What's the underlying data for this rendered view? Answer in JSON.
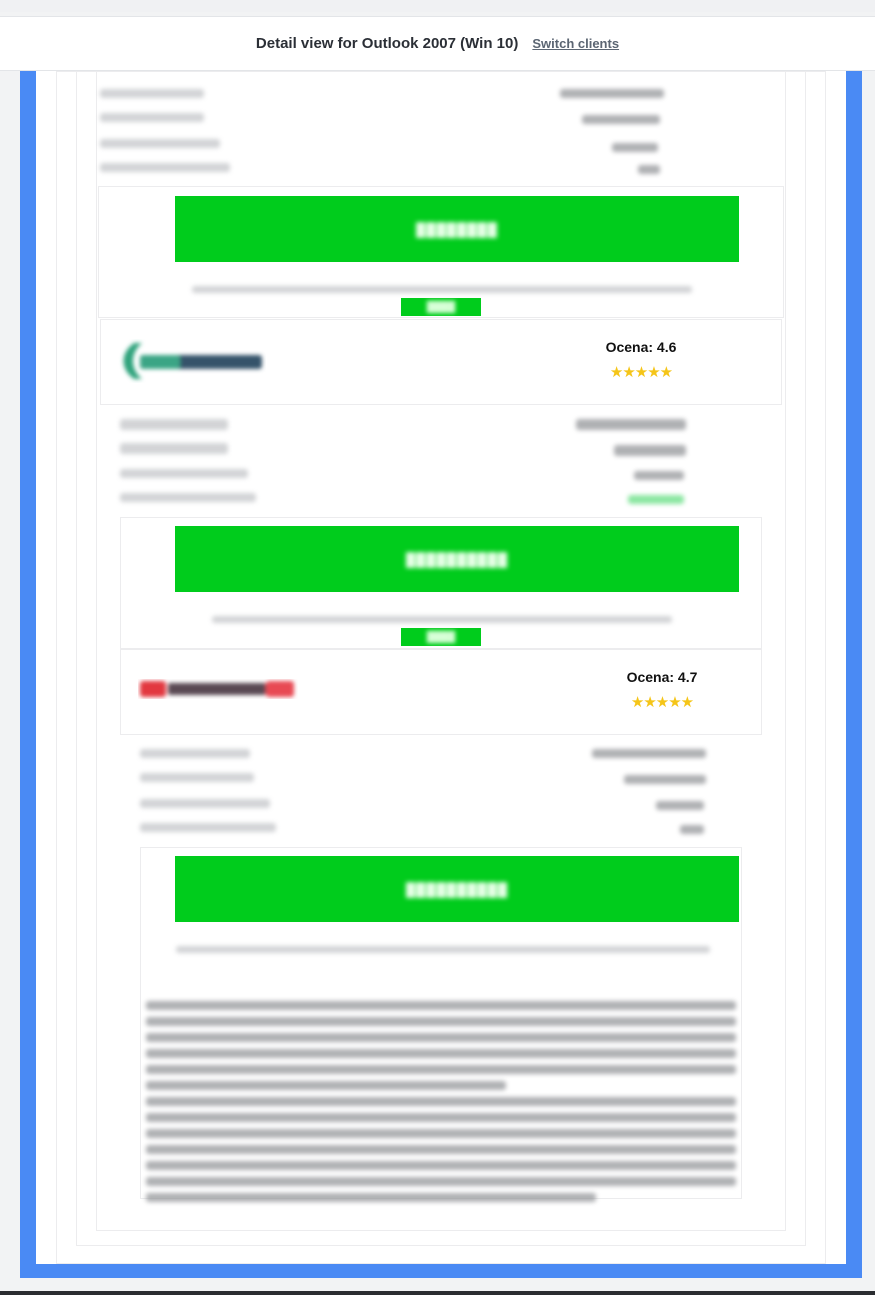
{
  "header": {
    "title": "Detail view for Outlook 2007 (Win 10)",
    "switch_label": "Switch clients"
  },
  "offers": [
    {
      "logo_icon": "green-arrow-logo-icon",
      "rating_label": "Ocena: 4.6",
      "stars": "★★★★★",
      "stars_value": 5
    },
    {
      "logo_icon": "red-brand-logo-icon",
      "rating_label": "Ocena: 4.7",
      "stars": "★★★★★",
      "stars_value": 5
    }
  ],
  "colors": {
    "frame": "#4a8af4",
    "cta_green": "#00cc1c",
    "star": "#f5c518"
  }
}
